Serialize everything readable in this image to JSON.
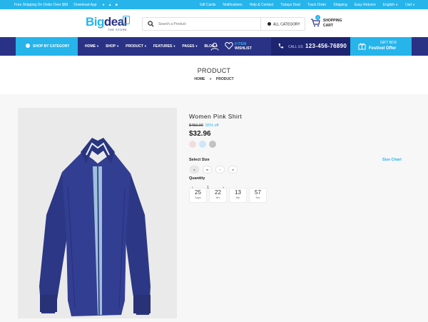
{
  "colors": {
    "accent": "#26b4ea",
    "navy": "#2a3285",
    "navy_dark": "#1d2470"
  },
  "topbar": {
    "free_shipping": "Free Shipping On Order Over $99",
    "download_app": "Download App",
    "links": [
      "Gift Cards",
      "Notifications",
      "Help & Contact",
      "Todays Deal",
      "Track Order",
      "Shipping",
      "Easy Returns"
    ],
    "language": "English",
    "currency": "Usd"
  },
  "header": {
    "logo_part1": "Big",
    "logo_part2": "deal",
    "logo_tagline": "THE STORE",
    "search_placeholder": "Search a Product",
    "category_select": "ALL CATEGORY",
    "cart_count": "0",
    "cart_line1": "SHOPPING",
    "cart_line2": "CART"
  },
  "nav": {
    "shop_by_category": "SHOP BY CATEGORY",
    "menu": [
      "HOME",
      "SHOP",
      "PRODUCT",
      "FEATURES",
      "PAGES",
      "BLOG"
    ],
    "wishlist_count": "0 ITEM",
    "wishlist_label": "WISHLIST",
    "call_label": "CALL US",
    "phone": "123-456-76890",
    "gift_line1": "GIFT BOX",
    "gift_line2": "Festivel Offer"
  },
  "page": {
    "title": "PRODUCT",
    "breadcrumb": [
      "HOME",
      "PRODUCT"
    ]
  },
  "product": {
    "name": "Women Pink Shirt",
    "old_price": "$459.00",
    "discount": "55% off",
    "price": "$32.96",
    "colors": [
      "#f2dddd",
      "#cfe6f6",
      "#c2c2c2"
    ],
    "select_size_label": "Select Size",
    "size_chart_label": "Size Chart",
    "sizes": [
      "s",
      "m",
      "l",
      "xl"
    ],
    "quantity_label": "Quantity",
    "quantity": "1",
    "timer": [
      {
        "value": "25",
        "unit": "Days"
      },
      {
        "value": "22",
        "unit": "Hrs"
      },
      {
        "value": "13",
        "unit": "Min"
      },
      {
        "value": "57",
        "unit": "Sec"
      }
    ]
  }
}
